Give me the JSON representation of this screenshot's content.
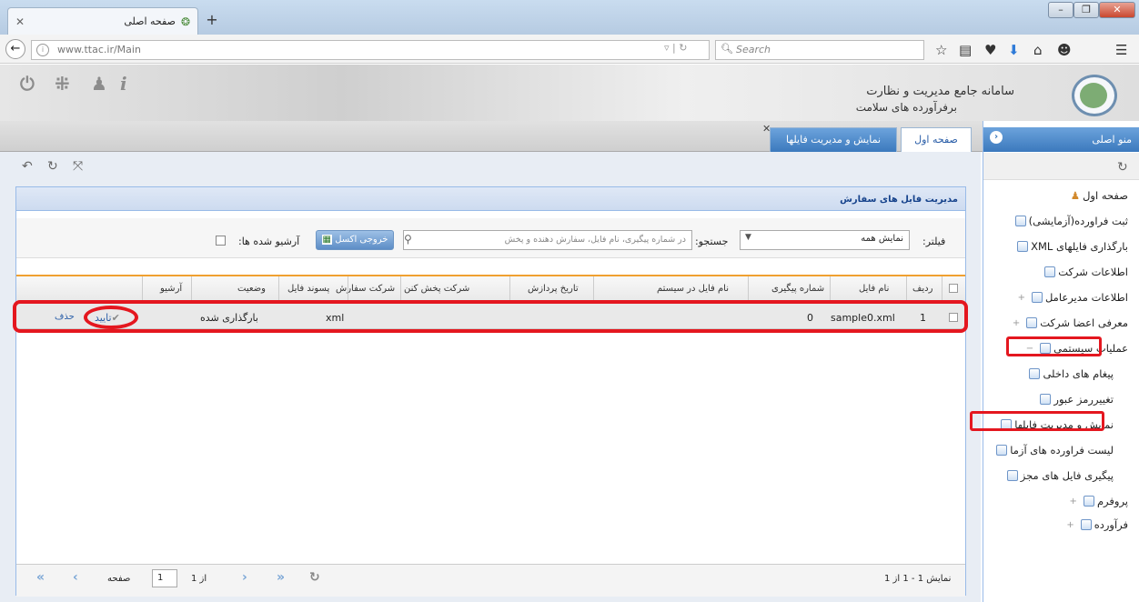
{
  "browser": {
    "tab_title": "صفحه اصلی",
    "url": "www.ttac.ir/Main",
    "search_placeholder": "Search"
  },
  "app": {
    "title_line1": "سامانه جامع مدیریت و نظارت",
    "title_line2": "برفرآورده های سلامت",
    "tabs": [
      "نمایش و مدیریت فایلها",
      "صفحه اول"
    ]
  },
  "grid": {
    "title": "مدیریت فایل های سفارش",
    "filter_label": "فیلتر:",
    "filter_value": "نمایش همه",
    "search_label": "جستجو:",
    "search_placeholder": "در شماره پیگیری، نام فایل، سفارش دهنده و پخش",
    "excel_button": "خروجی اکسل",
    "archived_label": "آرشیو شده ها:",
    "columns": [
      "ردیف",
      "نام فایل",
      "شماره پیگیری",
      "نام فایل در سیستم",
      "تاریخ پردازش",
      "شرکت پخش کنن",
      "شرکت سفارش",
      "پسوند فایل",
      "وضعیت",
      "آرشیو"
    ],
    "rows": [
      {
        "index": "1",
        "file_name": "sample0.xml",
        "tracking": "0",
        "extension": "xml",
        "status": "بارگذاری شده",
        "confirm": "تایید",
        "delete": "حذف"
      }
    ],
    "pager": {
      "page_label": "صفحه",
      "page_value": "1",
      "of_label": "از 1",
      "display_info": "نمایش 1 - 1 از 1"
    }
  },
  "sidebar": {
    "title": "منو اصلی",
    "items": [
      "صفحه اول",
      "ثبت فراورده(آزمایشی)",
      "بارگذاری فایلهای XML",
      "اطلاعات شرکت",
      "اطلاعات مدیرعامل",
      "معرفی اعضا شرکت",
      "عملیات سیستمی",
      "پیغام های داخلی",
      "تغییررمز عبور",
      "نمایش و مدیریت فایلها",
      "لیست فراورده های آزما",
      "پیگیری فایل های مجز",
      "پروفرم",
      "فرآورده"
    ]
  }
}
